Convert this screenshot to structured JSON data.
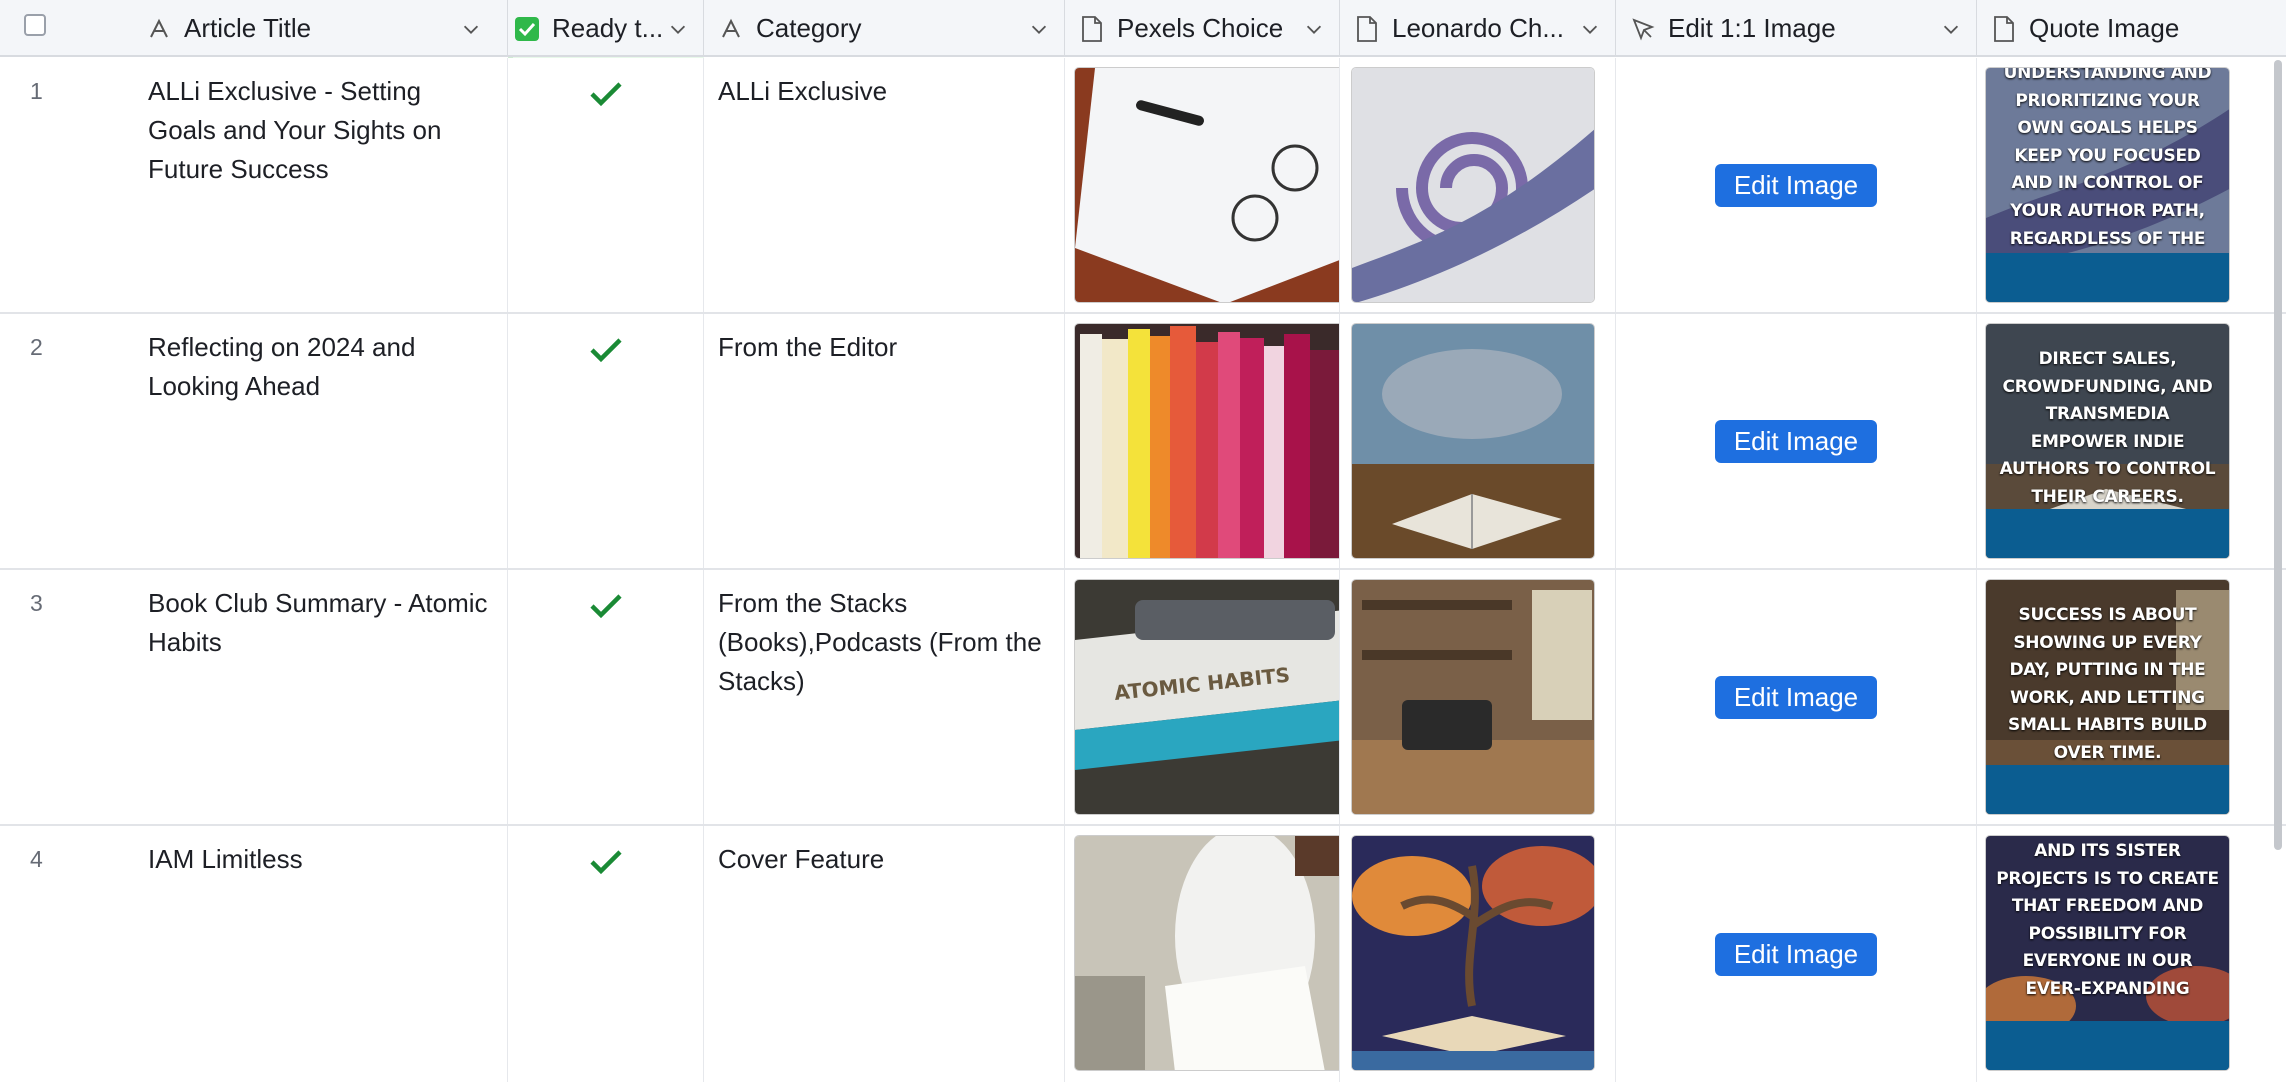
{
  "columns": {
    "title": "Article Title",
    "ready": "Ready t...",
    "category": "Category",
    "pexels": "Pexels Choice",
    "leonardo": "Leonardo Ch...",
    "edit": "Edit 1:1 Image",
    "quote": "Quote Image"
  },
  "colors": {
    "accent": "#1e6fe0",
    "check": "#1a8a35",
    "ready_bg": "#e8f8ea",
    "quote_band": "#0b5d91"
  },
  "icons": {
    "title": "text-icon",
    "ready": "checkbox-checked-icon",
    "category": "text-icon",
    "pexels": "file-icon",
    "leonardo": "file-icon",
    "edit": "cursor-icon",
    "quote": "file-icon"
  },
  "rows": [
    {
      "num": "1",
      "title": "ALLi Exclusive - Setting Goals and Your Sights on Future Success",
      "category": "ALLi Exclusive",
      "edit_label": "Edit Image",
      "quote": "UNDERSTANDING AND PRIORITIZING YOUR OWN GOALS HELPS KEEP YOU FOCUSED AND IN CONTROL OF YOUR AUTHOR PATH, REGARDLESS OF THE STAGE OF YOUR BUSINESS."
    },
    {
      "num": "2",
      "title": "Reflecting on 2024 and Looking Ahead",
      "category": "From the Editor",
      "edit_label": "Edit Image",
      "quote": "DIRECT SALES, CROWDFUNDING, AND TRANSMEDIA EMPOWER INDIE AUTHORS TO CONTROL THEIR CAREERS."
    },
    {
      "num": "3",
      "title": "Book Club Summary - Atomic Habits",
      "category": "From the Stacks (Books),Podcasts (From the Stacks)",
      "edit_label": "Edit Image",
      "quote": "SUCCESS IS ABOUT SHOWING UP EVERY DAY, PUTTING IN THE WORK, AND LETTING SMALL HABITS BUILD OVER TIME."
    },
    {
      "num": "4",
      "title": "IAM Limitless",
      "category": "Cover Feature",
      "edit_label": "Edit Image",
      "quote": "AND ITS SISTER PROJECTS IS TO CREATE THAT FREEDOM AND POSSIBILITY FOR EVERYONE IN OUR EVER-EXPANDING"
    }
  ]
}
